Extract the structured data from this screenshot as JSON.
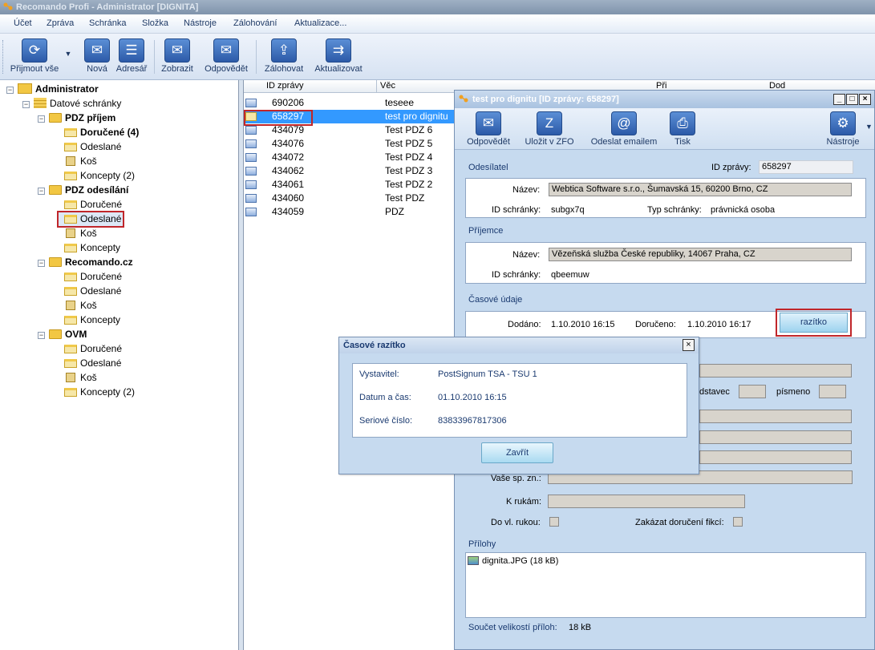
{
  "app": {
    "title": "Recomando Profi - Administrator [DIGNITA]"
  },
  "menu": [
    "Účet",
    "Zpráva",
    "Schránka",
    "Složka",
    "Nástroje",
    "Zálohování",
    "Aktualizace..."
  ],
  "toolbar": {
    "receive_all": "Přijmout vše",
    "new": "Nová",
    "addressee": "Adresář",
    "show": "Zobrazit",
    "reply": "Odpovědět",
    "backup": "Zálohovat",
    "update": "Aktualizovat"
  },
  "tree": {
    "root": "Administrator",
    "datove": "Datové schránky",
    "groups": [
      {
        "name": "PDZ příjem",
        "items": [
          "Doručené (4)",
          "Odeslané",
          "Koš",
          "Koncepty (2)"
        ]
      },
      {
        "name": "PDZ odesílání",
        "items": [
          "Doručené",
          "Odeslané",
          "Koš",
          "Koncepty"
        ]
      },
      {
        "name": "Recomando.cz",
        "items": [
          "Doručené",
          "Odeslané",
          "Koš",
          "Koncepty"
        ]
      },
      {
        "name": "OVM",
        "items": [
          "Doručené",
          "Odeslané",
          "Koš",
          "Koncepty (2)"
        ]
      }
    ]
  },
  "list": {
    "col_id": "ID zprávy",
    "col_subject": "Věc",
    "col_3": "Při",
    "col_4": "Dod",
    "rows": [
      {
        "id": "690206",
        "subject": "teseee"
      },
      {
        "id": "658297",
        "subject": "test pro dignitu"
      },
      {
        "id": "434079",
        "subject": "Test PDZ 6"
      },
      {
        "id": "434076",
        "subject": "Test PDZ 5"
      },
      {
        "id": "434072",
        "subject": "Test PDZ 4"
      },
      {
        "id": "434062",
        "subject": "Test PDZ 3"
      },
      {
        "id": "434061",
        "subject": "Test PDZ 2"
      },
      {
        "id": "434060",
        "subject": "Test PDZ"
      },
      {
        "id": "434059",
        "subject": "PDZ"
      }
    ]
  },
  "detail": {
    "title": "test pro dignitu [ID zprávy: 658297]",
    "tools": {
      "reply": "Odpovědět",
      "save_zfo": "Uložit v ZFO",
      "send_email": "Odeslat emailem",
      "print": "Tisk",
      "tools": "Nástroje"
    },
    "sender_section": "Odesílatel",
    "id_label": "ID zprávy:",
    "id_value": "658297",
    "name_label": "Název:",
    "sender_name": "Webtica Software s.r.o., Šumavská 15, 60200 Brno, CZ",
    "box_id_label": "ID schránky:",
    "sender_box_id": "subgx7q",
    "box_type_label": "Typ schránky:",
    "box_type": "právnická osoba",
    "recipient_section": "Příjemce",
    "recipient_name": "Vězeňská služba České republiky, 14067 Praha, CZ",
    "recipient_box_id": "qbeemuw",
    "time_section": "Časové údaje",
    "sent_label": "Dodáno:",
    "sent_value": "1.10.2010 16:15",
    "delivered_label": "Doručeno:",
    "delivered_value": "1.10.2010 16:17",
    "stamp_button": "razítko",
    "paragraph_label": "dstavec",
    "letter_label": "písmeno",
    "your_file_label": "Vaše sp. zn.:",
    "hands_label": "K rukám:",
    "own_hands_label": "Do vl. rukou:",
    "no_fiction_label": "Zakázat doručení fikcí:",
    "attachments_section": "Přílohy",
    "attachment": "dignita.JPG (18 kB)",
    "total_label": "Součet velikostí příloh:",
    "total_value": "18 kB"
  },
  "stamp_dialog": {
    "title": "Časové razítko",
    "issuer_label": "Vystavitel:",
    "issuer_value": "PostSignum TSA - TSU 1",
    "datetime_label": "Datum a čas:",
    "datetime_value": "01.10.2010 16:15",
    "serial_label": "Seriové číslo:",
    "serial_value": "83833967817306",
    "close_button": "Zavřít"
  },
  "colors": {
    "accent": "#3399ff",
    "highlight": "#c0262a",
    "panel": "#c6daef"
  }
}
